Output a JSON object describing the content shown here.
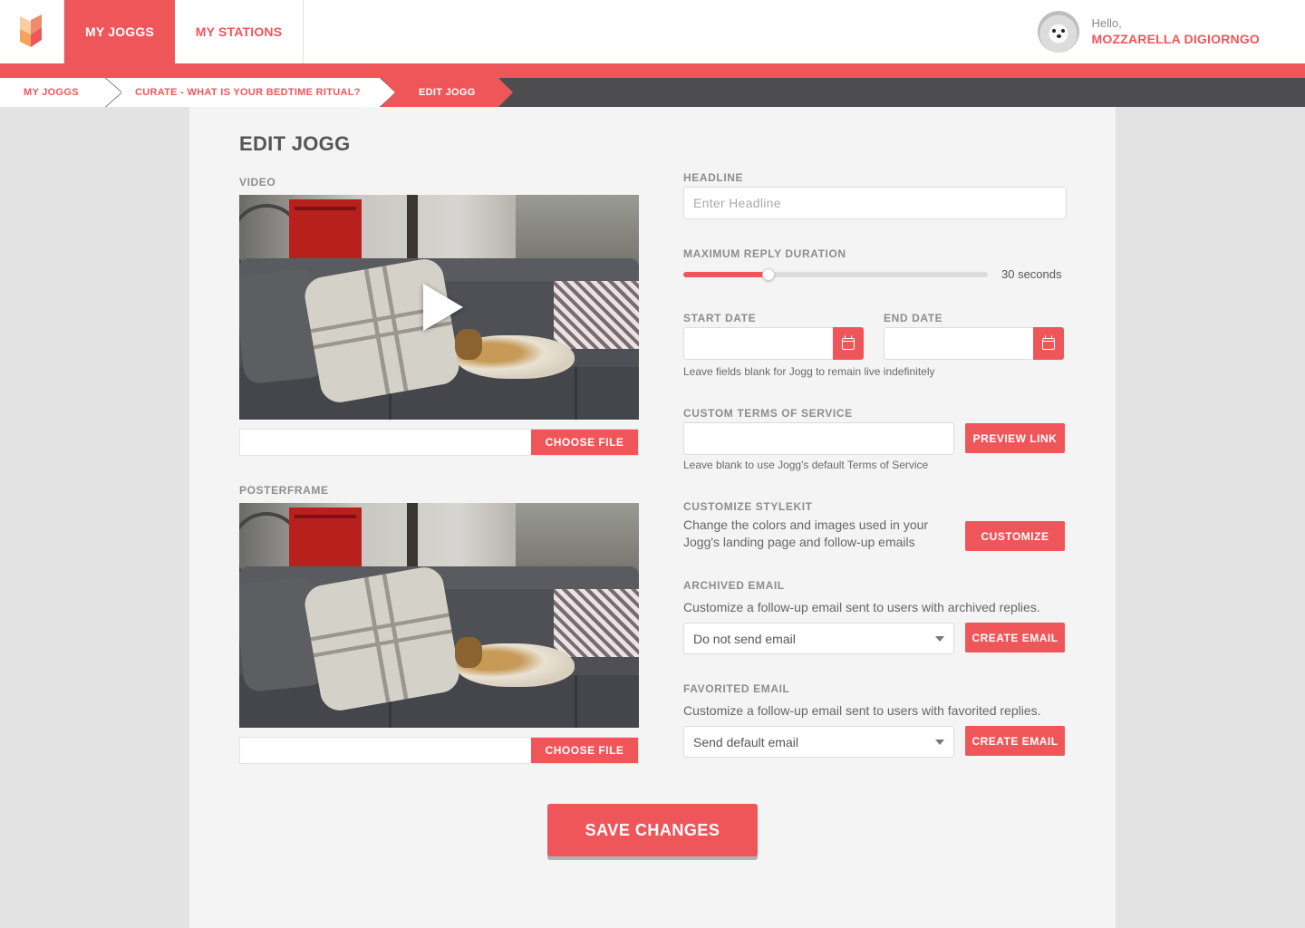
{
  "nav": {
    "logo_icon": "jogg-logo-icon",
    "tabs": [
      {
        "label": "MY JOGGS",
        "active": true
      },
      {
        "label": "MY STATIONS",
        "active": false
      }
    ]
  },
  "user": {
    "greeting": "Hello,",
    "name": "MOZZARELLA DIGIORNGO",
    "avatar_icon": "avatar-icon"
  },
  "breadcrumb": [
    {
      "label": "MY JOGGS"
    },
    {
      "label": "CURATE - WHAT IS YOUR BEDTIME RITUAL?"
    },
    {
      "label": "EDIT JOGG"
    }
  ],
  "colors": {
    "accent": "#ef565a",
    "dark": "#4d4d50",
    "panel": "#f4f4f4"
  },
  "page": {
    "title": "EDIT JOGG"
  },
  "video": {
    "label": "VIDEO",
    "play_icon": "play-icon",
    "file_value": "",
    "choose_label": "CHOOSE FILE"
  },
  "posterframe": {
    "label": "POSTERFRAME",
    "file_value": "",
    "choose_label": "CHOOSE FILE"
  },
  "headline": {
    "label": "HEADLINE",
    "value": "",
    "placeholder": "Enter Headline"
  },
  "reply_duration": {
    "label": "MAXIMUM REPLY DURATION",
    "value_fraction": 0.28,
    "value_text": "30 seconds"
  },
  "dates": {
    "start_label": "START DATE",
    "end_label": "END DATE",
    "start_value": "",
    "end_value": "",
    "calendar_icon": "calendar-icon",
    "help": "Leave fields blank for Jogg to remain live indefinitely"
  },
  "terms": {
    "label": "CUSTOM TERMS OF SERVICE",
    "value": "",
    "button": "PREVIEW LINK",
    "help": "Leave blank to use Jogg's default Terms of Service"
  },
  "stylekit": {
    "label": "CUSTOMIZE STYLEKIT",
    "description": "Change the colors and images used in your Jogg's landing page and follow-up emails",
    "button": "CUSTOMIZE"
  },
  "archived_email": {
    "label": "ARCHIVED EMAIL",
    "description": "Customize a follow-up email sent to users with archived replies.",
    "selected": "Do not send email",
    "button": "CREATE EMAIL"
  },
  "favorited_email": {
    "label": "FAVORITED EMAIL",
    "description": "Customize a follow-up email sent to users with favorited replies.",
    "selected": "Send default email",
    "button": "CREATE EMAIL"
  },
  "save": {
    "label": "SAVE CHANGES"
  }
}
